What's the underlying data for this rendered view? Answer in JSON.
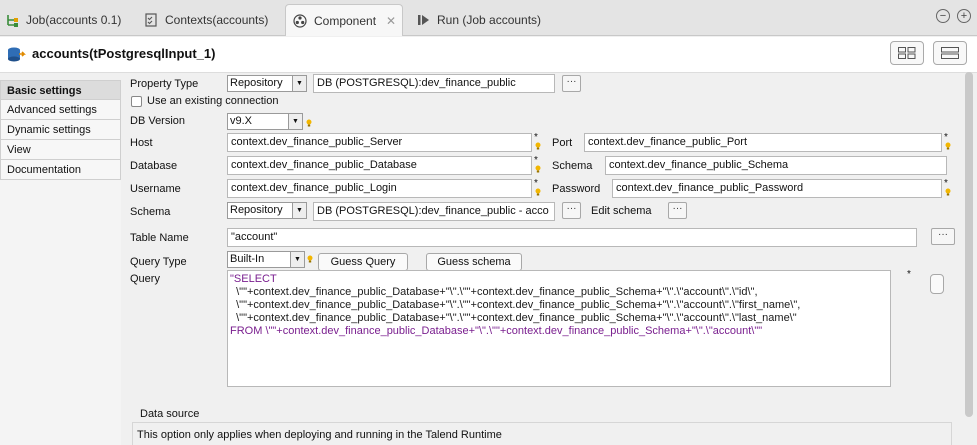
{
  "tabs": [
    {
      "label": "Job(accounts 0.1)",
      "icon": "job-icon"
    },
    {
      "label": "Contexts(accounts)",
      "icon": "contexts-icon"
    },
    {
      "label": "Component",
      "icon": "component-icon",
      "active": true,
      "close": "✕"
    },
    {
      "label": "Run (Job accounts)",
      "icon": "run-icon"
    }
  ],
  "window": {
    "minimize": "−",
    "maximize": "+"
  },
  "header": {
    "title": "accounts(tPostgresqlInput_1)"
  },
  "nav": [
    {
      "label": "Basic settings",
      "active": true
    },
    {
      "label": "Advanced settings"
    },
    {
      "label": "Dynamic settings"
    },
    {
      "label": "View"
    },
    {
      "label": "Documentation"
    }
  ],
  "form": {
    "property_type_label": "Property Type",
    "property_type_value": "Repository",
    "property_type_repo": "DB (POSTGRESQL):dev_finance_public",
    "use_existing_label": "Use an existing connection",
    "db_version_label": "DB Version",
    "db_version_value": "v9.X",
    "host_label": "Host",
    "host_value": "context.dev_finance_public_Server",
    "port_label": "Port",
    "port_value": "context.dev_finance_public_Port",
    "database_label": "Database",
    "database_value": "context.dev_finance_public_Database",
    "schema_label": "Schema",
    "schema_value": "context.dev_finance_public_Schema",
    "username_label": "Username",
    "username_value": "context.dev_finance_public_Login",
    "password_label": "Password",
    "password_value": "context.dev_finance_public_Password",
    "schema2_label": "Schema",
    "schema2_type": "Repository",
    "schema2_repo": "DB (POSTGRESQL):dev_finance_public - acco",
    "edit_schema_label": "Edit schema",
    "table_name_label": "Table Name",
    "table_name_value": "\"account\"",
    "query_type_label": "Query Type",
    "query_type_value": "Built-In",
    "guess_query_label": "Guess Query",
    "guess_schema_label": "Guess schema",
    "query_label": "Query",
    "query_lines": [
      "\"SELECT",
      "  \\\"\"+context.dev_finance_public_Database+\"\\\".\\\"\"+context.dev_finance_public_Schema+\"\\\".\\\"account\\\".\\\"id\\\",",
      "  \\\"\"+context.dev_finance_public_Database+\"\\\".\\\"\"+context.dev_finance_public_Schema+\"\\\".\\\"account\\\".\\\"first_name\\\",",
      "  \\\"\"+context.dev_finance_public_Database+\"\\\".\\\"\"+context.dev_finance_public_Schema+\"\\\".\\\"account\\\".\\\"last_name\\\"",
      "FROM \\\"\"+context.dev_finance_public_Database+\"\\\".\\\"\"+context.dev_finance_public_Schema+\"\\\".\\\"account\\\"\""
    ],
    "data_source_label": "Data source",
    "data_source_note": "This option only applies when deploying and running in the Talend Runtime",
    "dots": "···",
    "required": "*"
  }
}
